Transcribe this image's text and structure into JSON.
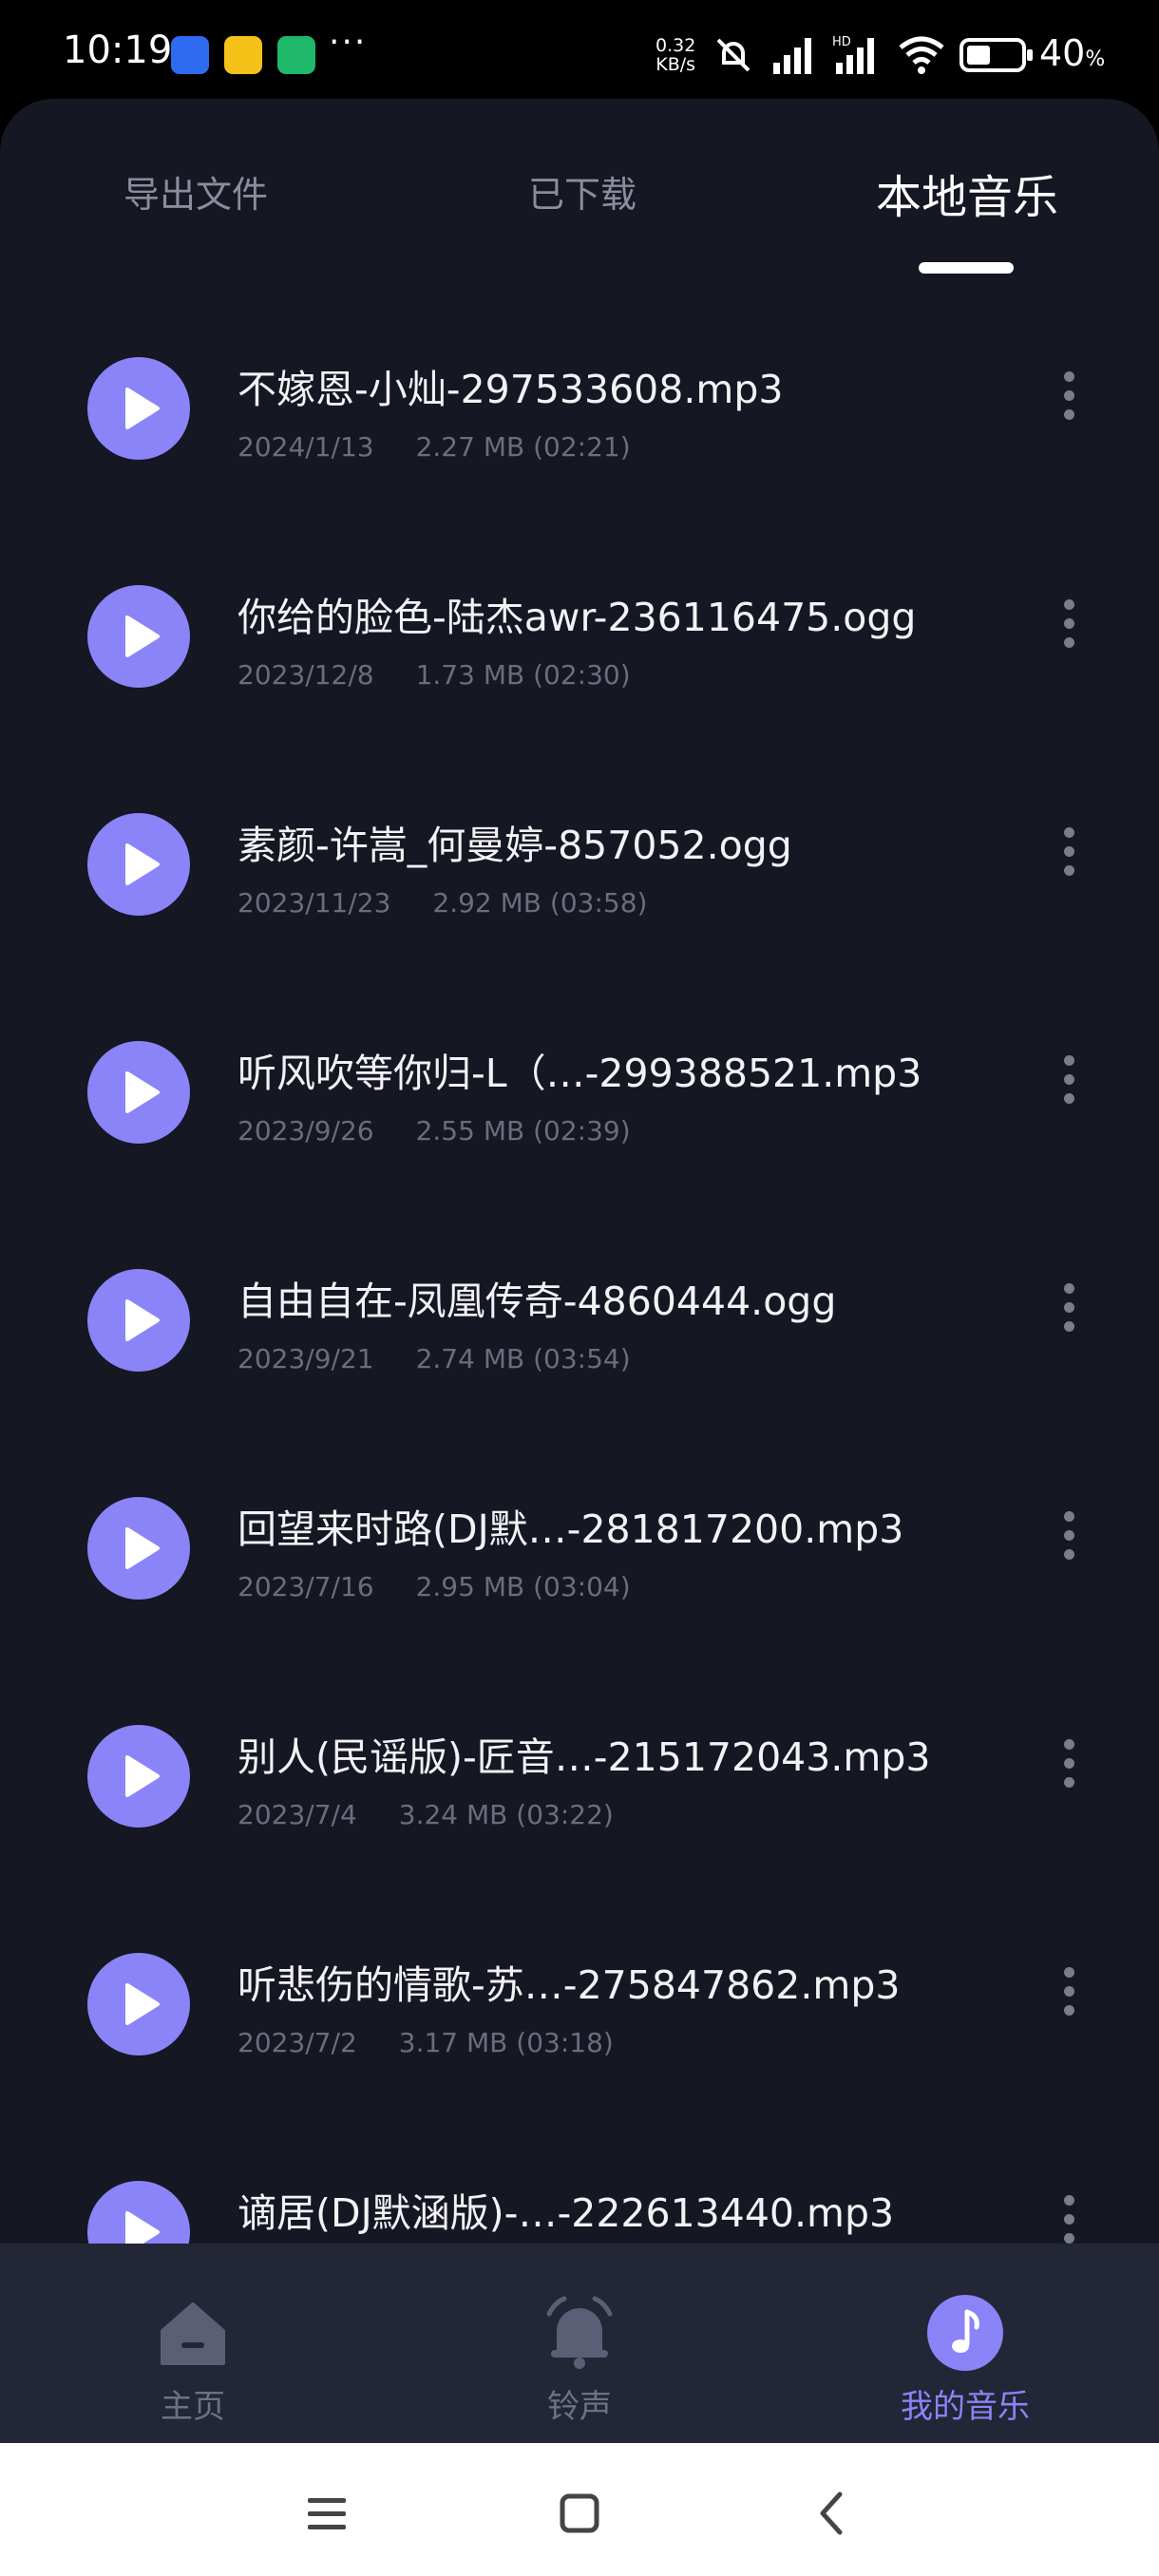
{
  "status_bar": {
    "time": "10:19",
    "net_speed_value": "0.32",
    "net_speed_unit": "KB/s",
    "battery_percent": "40",
    "battery_unit": "%",
    "more": "···"
  },
  "tabs": [
    {
      "label": "导出文件",
      "active": false
    },
    {
      "label": "已下载",
      "active": false
    },
    {
      "label": "本地音乐",
      "active": true
    }
  ],
  "songs": [
    {
      "title": "不嫁恩-小灿-297533608.mp3",
      "date": "2024/1/13",
      "info": "2.27 MB (02:21)"
    },
    {
      "title": "你给的脸色-陆杰awr-236116475.ogg",
      "date": "2023/12/8",
      "info": "1.73 MB (02:30)"
    },
    {
      "title": "素颜-许嵩_何曼婷-857052.ogg",
      "date": "2023/11/23",
      "info": "2.92 MB (03:58)"
    },
    {
      "title": "听风吹等你归-L（…-299388521.mp3",
      "date": "2023/9/26",
      "info": "2.55 MB (02:39)"
    },
    {
      "title": "自由自在-凤凰传奇-4860444.ogg",
      "date": "2023/9/21",
      "info": "2.74 MB (03:54)"
    },
    {
      "title": "回望来时路(DJ默…-281817200.mp3",
      "date": "2023/7/16",
      "info": "2.95 MB (03:04)"
    },
    {
      "title": "别人(民谣版)-匠音…-215172043.mp3",
      "date": "2023/7/4",
      "info": "3.24 MB (03:22)"
    },
    {
      "title": "听悲伤的情歌-苏…-275847862.mp3",
      "date": "2023/7/2",
      "info": "3.17 MB (03:18)"
    },
    {
      "title": "谪居(DJ默涵版)-…-222613440.mp3",
      "date": "",
      "info": ""
    }
  ],
  "bottom_nav": [
    {
      "label": "主页",
      "icon": "home-icon",
      "active": false
    },
    {
      "label": "铃声",
      "icon": "bell-icon",
      "active": false
    },
    {
      "label": "我的音乐",
      "icon": "music-note-icon",
      "active": true
    }
  ],
  "colors": {
    "accent": "#8b84f8",
    "panel_bg": "#151722",
    "nav_bg": "#232636",
    "text_secondary": "#6a6d7b"
  }
}
